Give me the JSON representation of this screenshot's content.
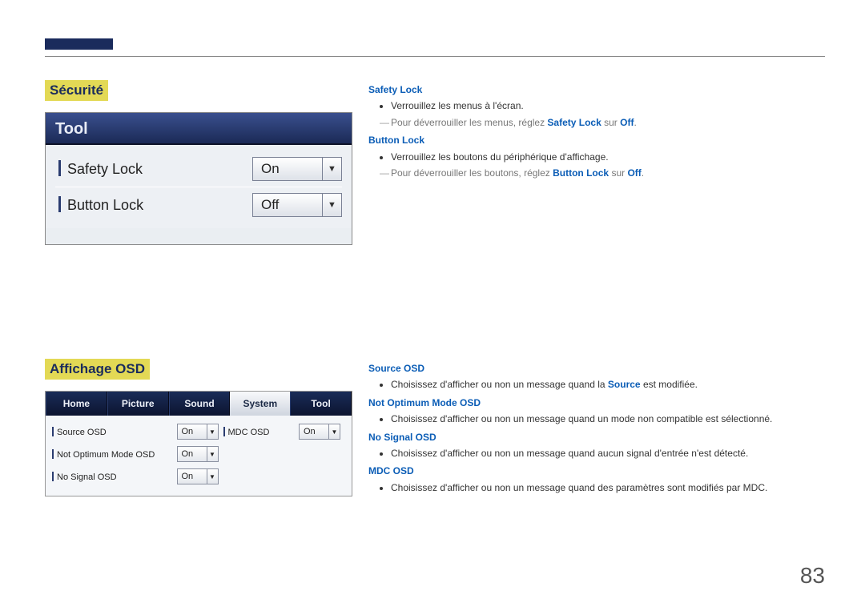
{
  "page_number": "83",
  "sections": {
    "security": {
      "heading": "Sécurité",
      "tool_header": "Tool",
      "items": [
        {
          "label": "Safety Lock",
          "value": "On"
        },
        {
          "label": "Button Lock",
          "value": "Off"
        }
      ],
      "desc": {
        "safety_lock": {
          "title": "Safety Lock",
          "bullet": "Verrouillez les menus à l'écran.",
          "note_pre": "Pour déverrouiller les menus, réglez ",
          "note_strong": "Safety Lock",
          "note_mid": " sur ",
          "note_strong2": "Off",
          "note_end": "."
        },
        "button_lock": {
          "title": "Button Lock",
          "bullet": "Verrouillez les boutons du périphérique d'affichage.",
          "note_pre": "Pour déverrouiller les boutons, réglez ",
          "note_strong": "Button Lock",
          "note_mid": " sur ",
          "note_strong2": "Off",
          "note_end": "."
        }
      }
    },
    "osd": {
      "heading": "Affichage OSD",
      "tabs": [
        "Home",
        "Picture",
        "Sound",
        "System",
        "Tool"
      ],
      "active_tab_index": 3,
      "left_items": [
        {
          "label": "Source OSD",
          "value": "On"
        },
        {
          "label": "Not Optimum Mode OSD",
          "value": "On"
        },
        {
          "label": "No Signal OSD",
          "value": "On"
        }
      ],
      "right_items": [
        {
          "label": "MDC OSD",
          "value": "On"
        }
      ],
      "desc": {
        "source_osd": {
          "title": "Source OSD",
          "bullet_pre": "Choisissez d'afficher ou non un message quand la ",
          "bullet_strong": "Source",
          "bullet_post": " est modifiée."
        },
        "not_optimum": {
          "title": "Not Optimum Mode OSD",
          "bullet": "Choisissez d'afficher ou non un message quand un mode non compatible est sélectionné."
        },
        "no_signal": {
          "title": "No Signal OSD",
          "bullet": "Choisissez d'afficher ou non un message quand aucun signal d'entrée n'est détecté."
        },
        "mdc_osd": {
          "title": "MDC OSD",
          "bullet": "Choisissez d'afficher ou non un message quand des paramètres sont modifiés par MDC."
        }
      }
    }
  }
}
